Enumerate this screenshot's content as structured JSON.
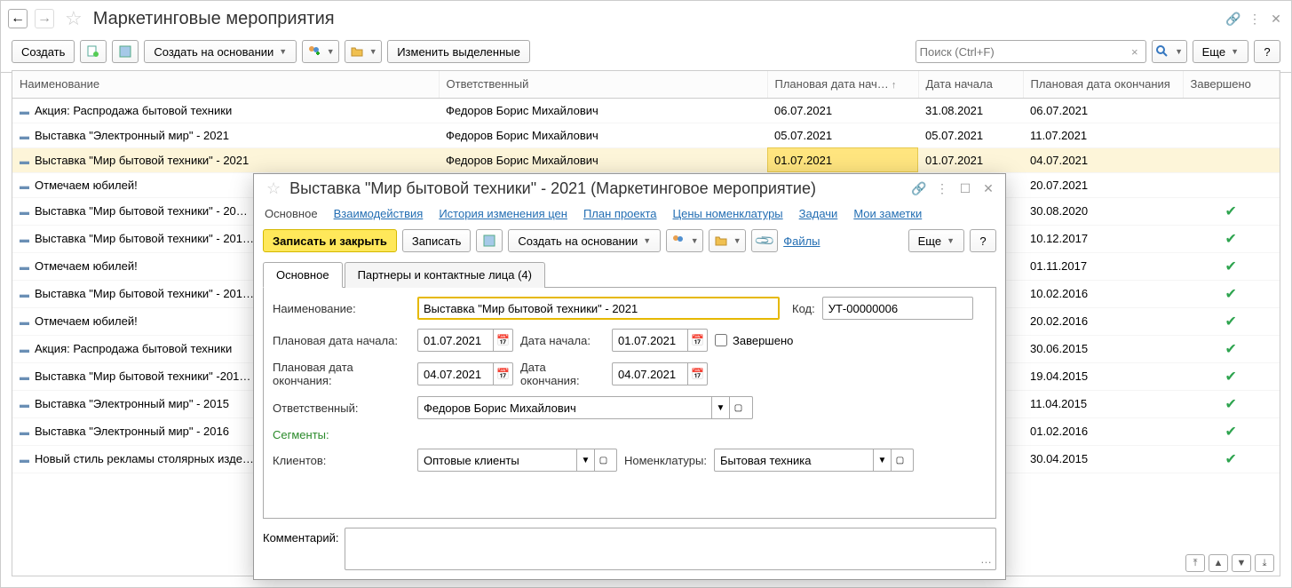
{
  "header": {
    "title": "Маркетинговые мероприятия",
    "search_placeholder": "Поиск (Ctrl+F)",
    "more_label": "Еще"
  },
  "toolbar": {
    "create": "Создать",
    "create_based_on": "Создать на основании",
    "change_selected": "Изменить выделенные"
  },
  "table": {
    "cols": {
      "name": "Наименование",
      "responsible": "Ответственный",
      "plan_start": "Плановая дата нач…",
      "actual_start": "Дата начала",
      "plan_end": "Плановая дата окончания",
      "completed": "Завершено"
    },
    "rows": [
      {
        "name": "Акция: Распродажа бытовой техники",
        "resp": "Федоров Борис Михайлович",
        "pstart": "06.07.2021",
        "astart": "31.08.2021",
        "pend": "06.07.2021",
        "done": false
      },
      {
        "name": "Выставка \"Электронный мир\" - 2021",
        "resp": "Федоров Борис Михайлович",
        "pstart": "05.07.2021",
        "astart": "05.07.2021",
        "pend": "11.07.2021",
        "done": false
      },
      {
        "name": "Выставка \"Мир бытовой техники\" - 2021",
        "resp": "Федоров Борис Михайлович",
        "pstart": "01.07.2021",
        "astart": "01.07.2021",
        "pend": "04.07.2021",
        "done": false,
        "selected": true
      },
      {
        "name": "Отмечаем юбилей!",
        "resp": "",
        "pstart": "",
        "astart": "",
        "pend": "20.07.2021",
        "done": false
      },
      {
        "name": "Выставка \"Мир бытовой техники\" - 20…",
        "resp": "",
        "pstart": "",
        "astart": "",
        "pend": "30.08.2020",
        "done": true
      },
      {
        "name": "Выставка \"Мир бытовой техники\" - 201…",
        "resp": "",
        "pstart": "",
        "astart": "",
        "pend": "10.12.2017",
        "done": true
      },
      {
        "name": "Отмечаем юбилей!",
        "resp": "",
        "pstart": "",
        "astart": "",
        "pend": "01.11.2017",
        "done": true
      },
      {
        "name": "Выставка \"Мир бытовой техники\" - 201…",
        "resp": "",
        "pstart": "",
        "astart": "",
        "pend": "10.02.2016",
        "done": true
      },
      {
        "name": "Отмечаем юбилей!",
        "resp": "",
        "pstart": "",
        "astart": "",
        "pend": "20.02.2016",
        "done": true
      },
      {
        "name": "Акция: Распродажа бытовой техники",
        "resp": "",
        "pstart": "",
        "astart": "",
        "pend": "30.06.2015",
        "done": true
      },
      {
        "name": "Выставка \"Мир бытовой техники\" -201…",
        "resp": "",
        "pstart": "",
        "astart": "",
        "pend": "19.04.2015",
        "done": true
      },
      {
        "name": "Выставка \"Электронный мир\" - 2015",
        "resp": "",
        "pstart": "",
        "astart": "",
        "pend": "11.04.2015",
        "done": true
      },
      {
        "name": "Выставка \"Электронный мир\" - 2016",
        "resp": "",
        "pstart": "",
        "astart": "",
        "pend": "01.02.2016",
        "done": true
      },
      {
        "name": "Новый стиль рекламы столярных изде…",
        "resp": "",
        "pstart": "",
        "astart": "",
        "pend": "30.04.2015",
        "done": true
      }
    ]
  },
  "dialog": {
    "title": "Выставка \"Мир бытовой техники\" - 2021 (Маркетинговое мероприятие)",
    "nav": {
      "main": "Основное",
      "interactions": "Взаимодействия",
      "price_history": "История изменения цен",
      "project_plan": "План проекта",
      "nomenclature_prices": "Цены номенклатуры",
      "tasks": "Задачи",
      "my_notes": "Мои заметки"
    },
    "toolbar": {
      "save_close": "Записать и закрыть",
      "save": "Записать",
      "create_based_on": "Создать на основании",
      "files": "Файлы",
      "more": "Еще"
    },
    "tabs": {
      "main": "Основное",
      "partners": "Партнеры и контактные лица (4)"
    },
    "form": {
      "name_label": "Наименование:",
      "name_value": "Выставка \"Мир бытовой техники\" - 2021",
      "code_label": "Код:",
      "code_value": "УТ-00000006",
      "plan_start_label": "Плановая дата начала:",
      "plan_start_value": "01.07.2021",
      "actual_start_label": "Дата начала:",
      "actual_start_value": "01.07.2021",
      "completed_label": "Завершено",
      "plan_end_label": "Плановая дата окончания:",
      "plan_end_value": "04.07.2021",
      "actual_end_label": "Дата окончания:",
      "actual_end_value": "04.07.2021",
      "responsible_label": "Ответственный:",
      "responsible_value": "Федоров Борис Михайлович",
      "segments_label": "Сегменты:",
      "clients_label": "Клиентов:",
      "clients_value": "Оптовые клиенты",
      "nomenclature_label": "Номенклатуры:",
      "nomenclature_value": "Бытовая техника",
      "comment_label": "Комментарий:"
    }
  }
}
